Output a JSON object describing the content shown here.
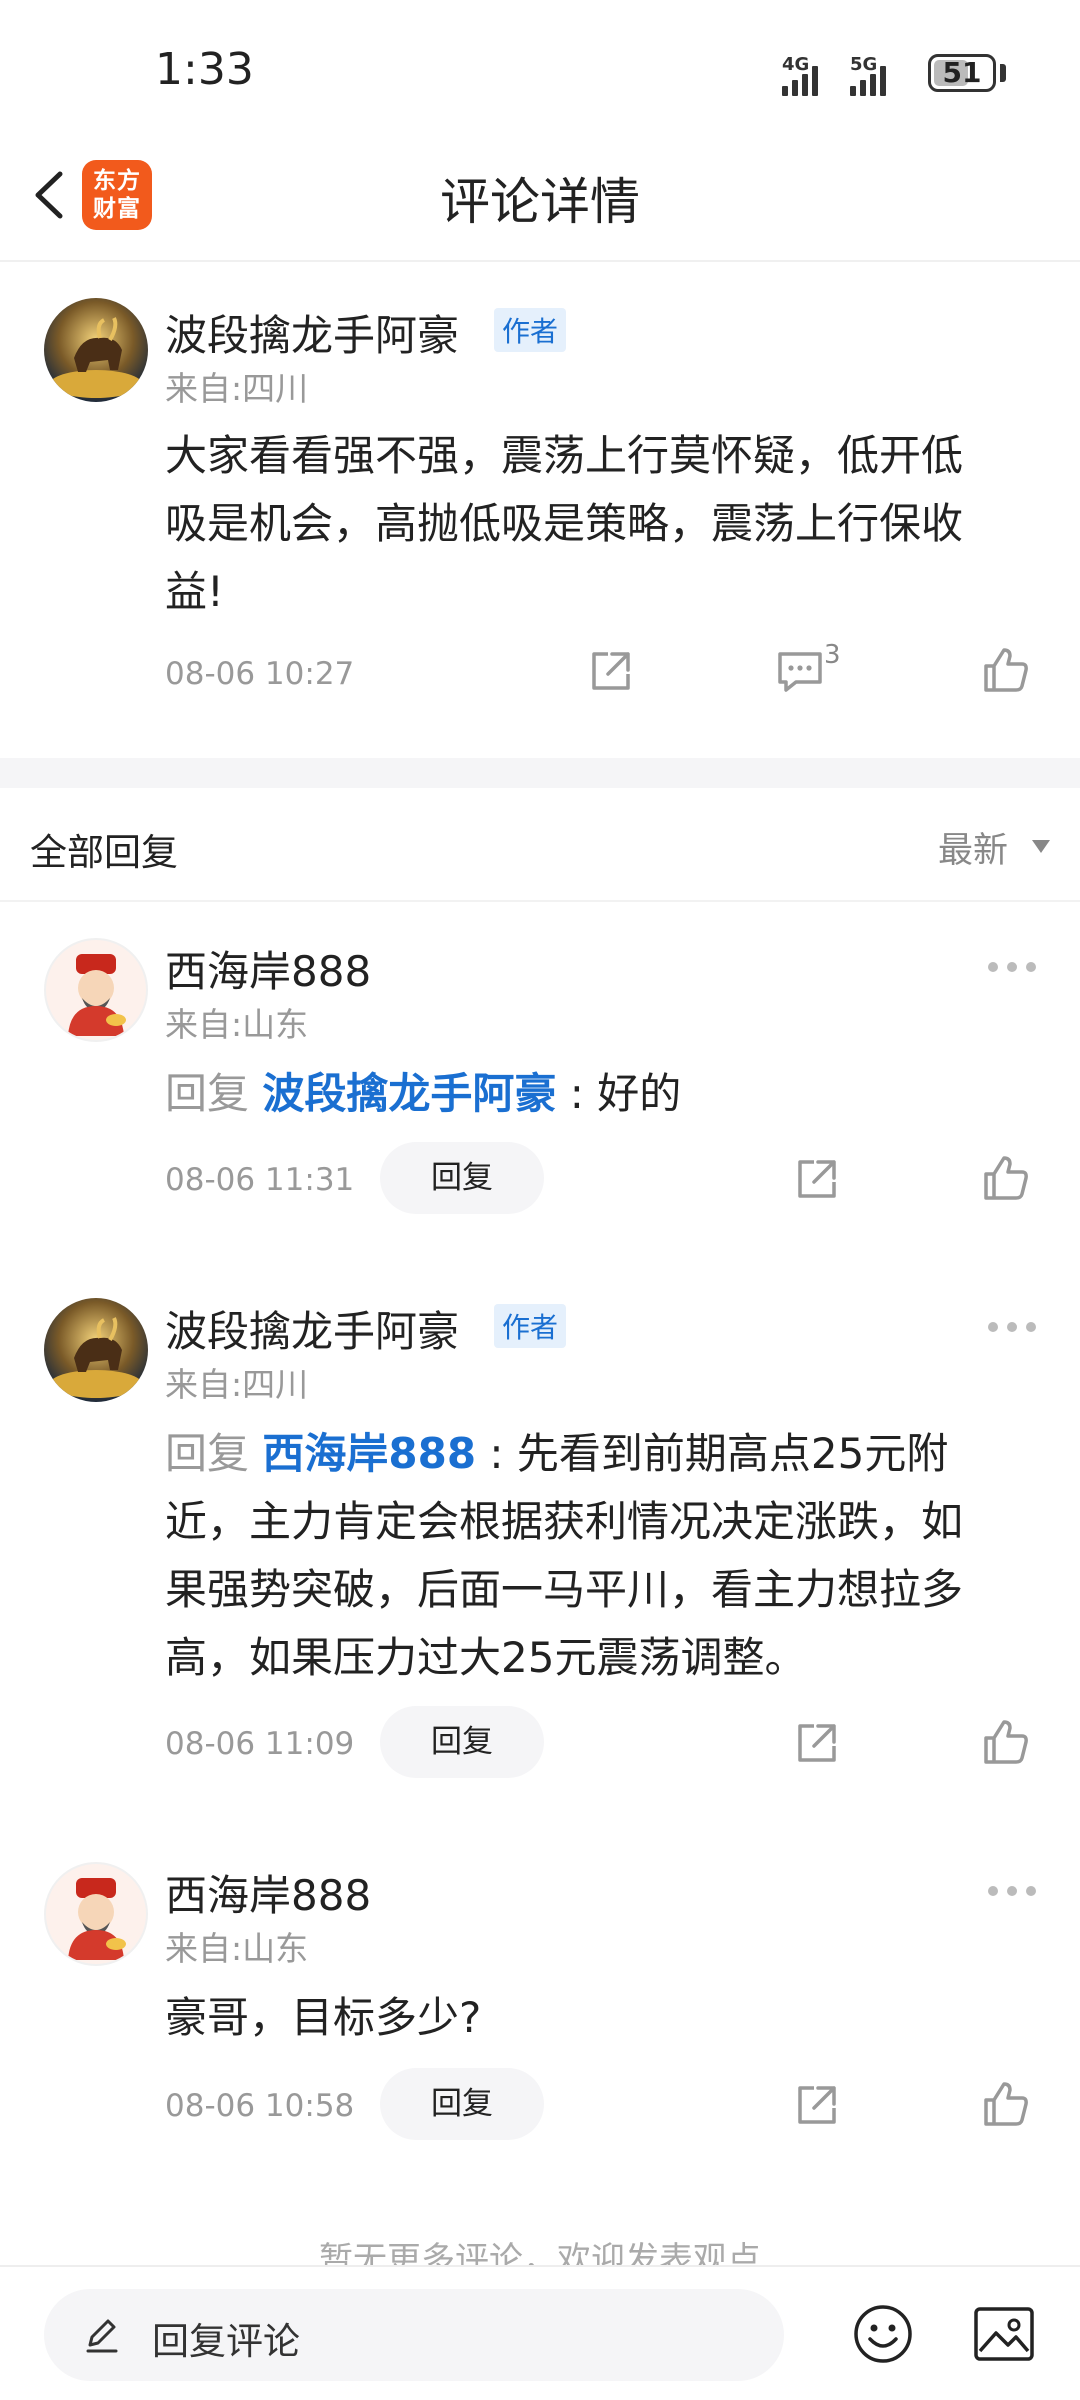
{
  "status_bar": {
    "time": "1:33",
    "signal_1": "4G",
    "signal_2": "5G",
    "battery": "51"
  },
  "header": {
    "title": "评论详情",
    "logo_line1": "东方",
    "logo_line2": "财富"
  },
  "main_comment": {
    "author": "波段擒龙手阿豪",
    "badge": "作者",
    "location": "来自:四川",
    "content_lines": [
      "大家看看强不强，震荡上行莫怀疑，低开低",
      "吸是机会，高抛低吸是策略，震荡上行保收",
      "益!"
    ],
    "time": "08-06 10:27",
    "reply_count": "3"
  },
  "section": {
    "title": "全部回复",
    "sort": "最新"
  },
  "replies": [
    {
      "author": "西海岸888",
      "location": "来自:山东",
      "prefix": "回复",
      "target": "波段擒龙手阿豪",
      "text_lines": [
        ": 好的"
      ],
      "time": "08-06 11:31",
      "reply_label": "回复"
    },
    {
      "author": "波段擒龙手阿豪",
      "badge": "作者",
      "location": "来自:四川",
      "prefix": "回复",
      "target": "西海岸888",
      "text_lines": [
        ": 先看到前期高点25元附",
        "近，主力肯定会根据获利情况决定涨跌，如",
        "果强势突破，后面一马平川，看主力想拉多",
        "高，如果压力过大25元震荡调整。"
      ],
      "time": "08-06 11:09",
      "reply_label": "回复"
    },
    {
      "author": "西海岸888",
      "location": "来自:山东",
      "text_lines": [
        "豪哥，目标多少?"
      ],
      "time": "08-06 10:58",
      "reply_label": "回复"
    }
  ],
  "footer_note": "暂无更多评论，欢迎发表观点",
  "bottom_bar": {
    "input_placeholder": "回复评论"
  },
  "colors": {
    "accent_blue": "#1a6fd1",
    "logo_orange": "#f25a1c",
    "muted_gray": "#999999"
  }
}
